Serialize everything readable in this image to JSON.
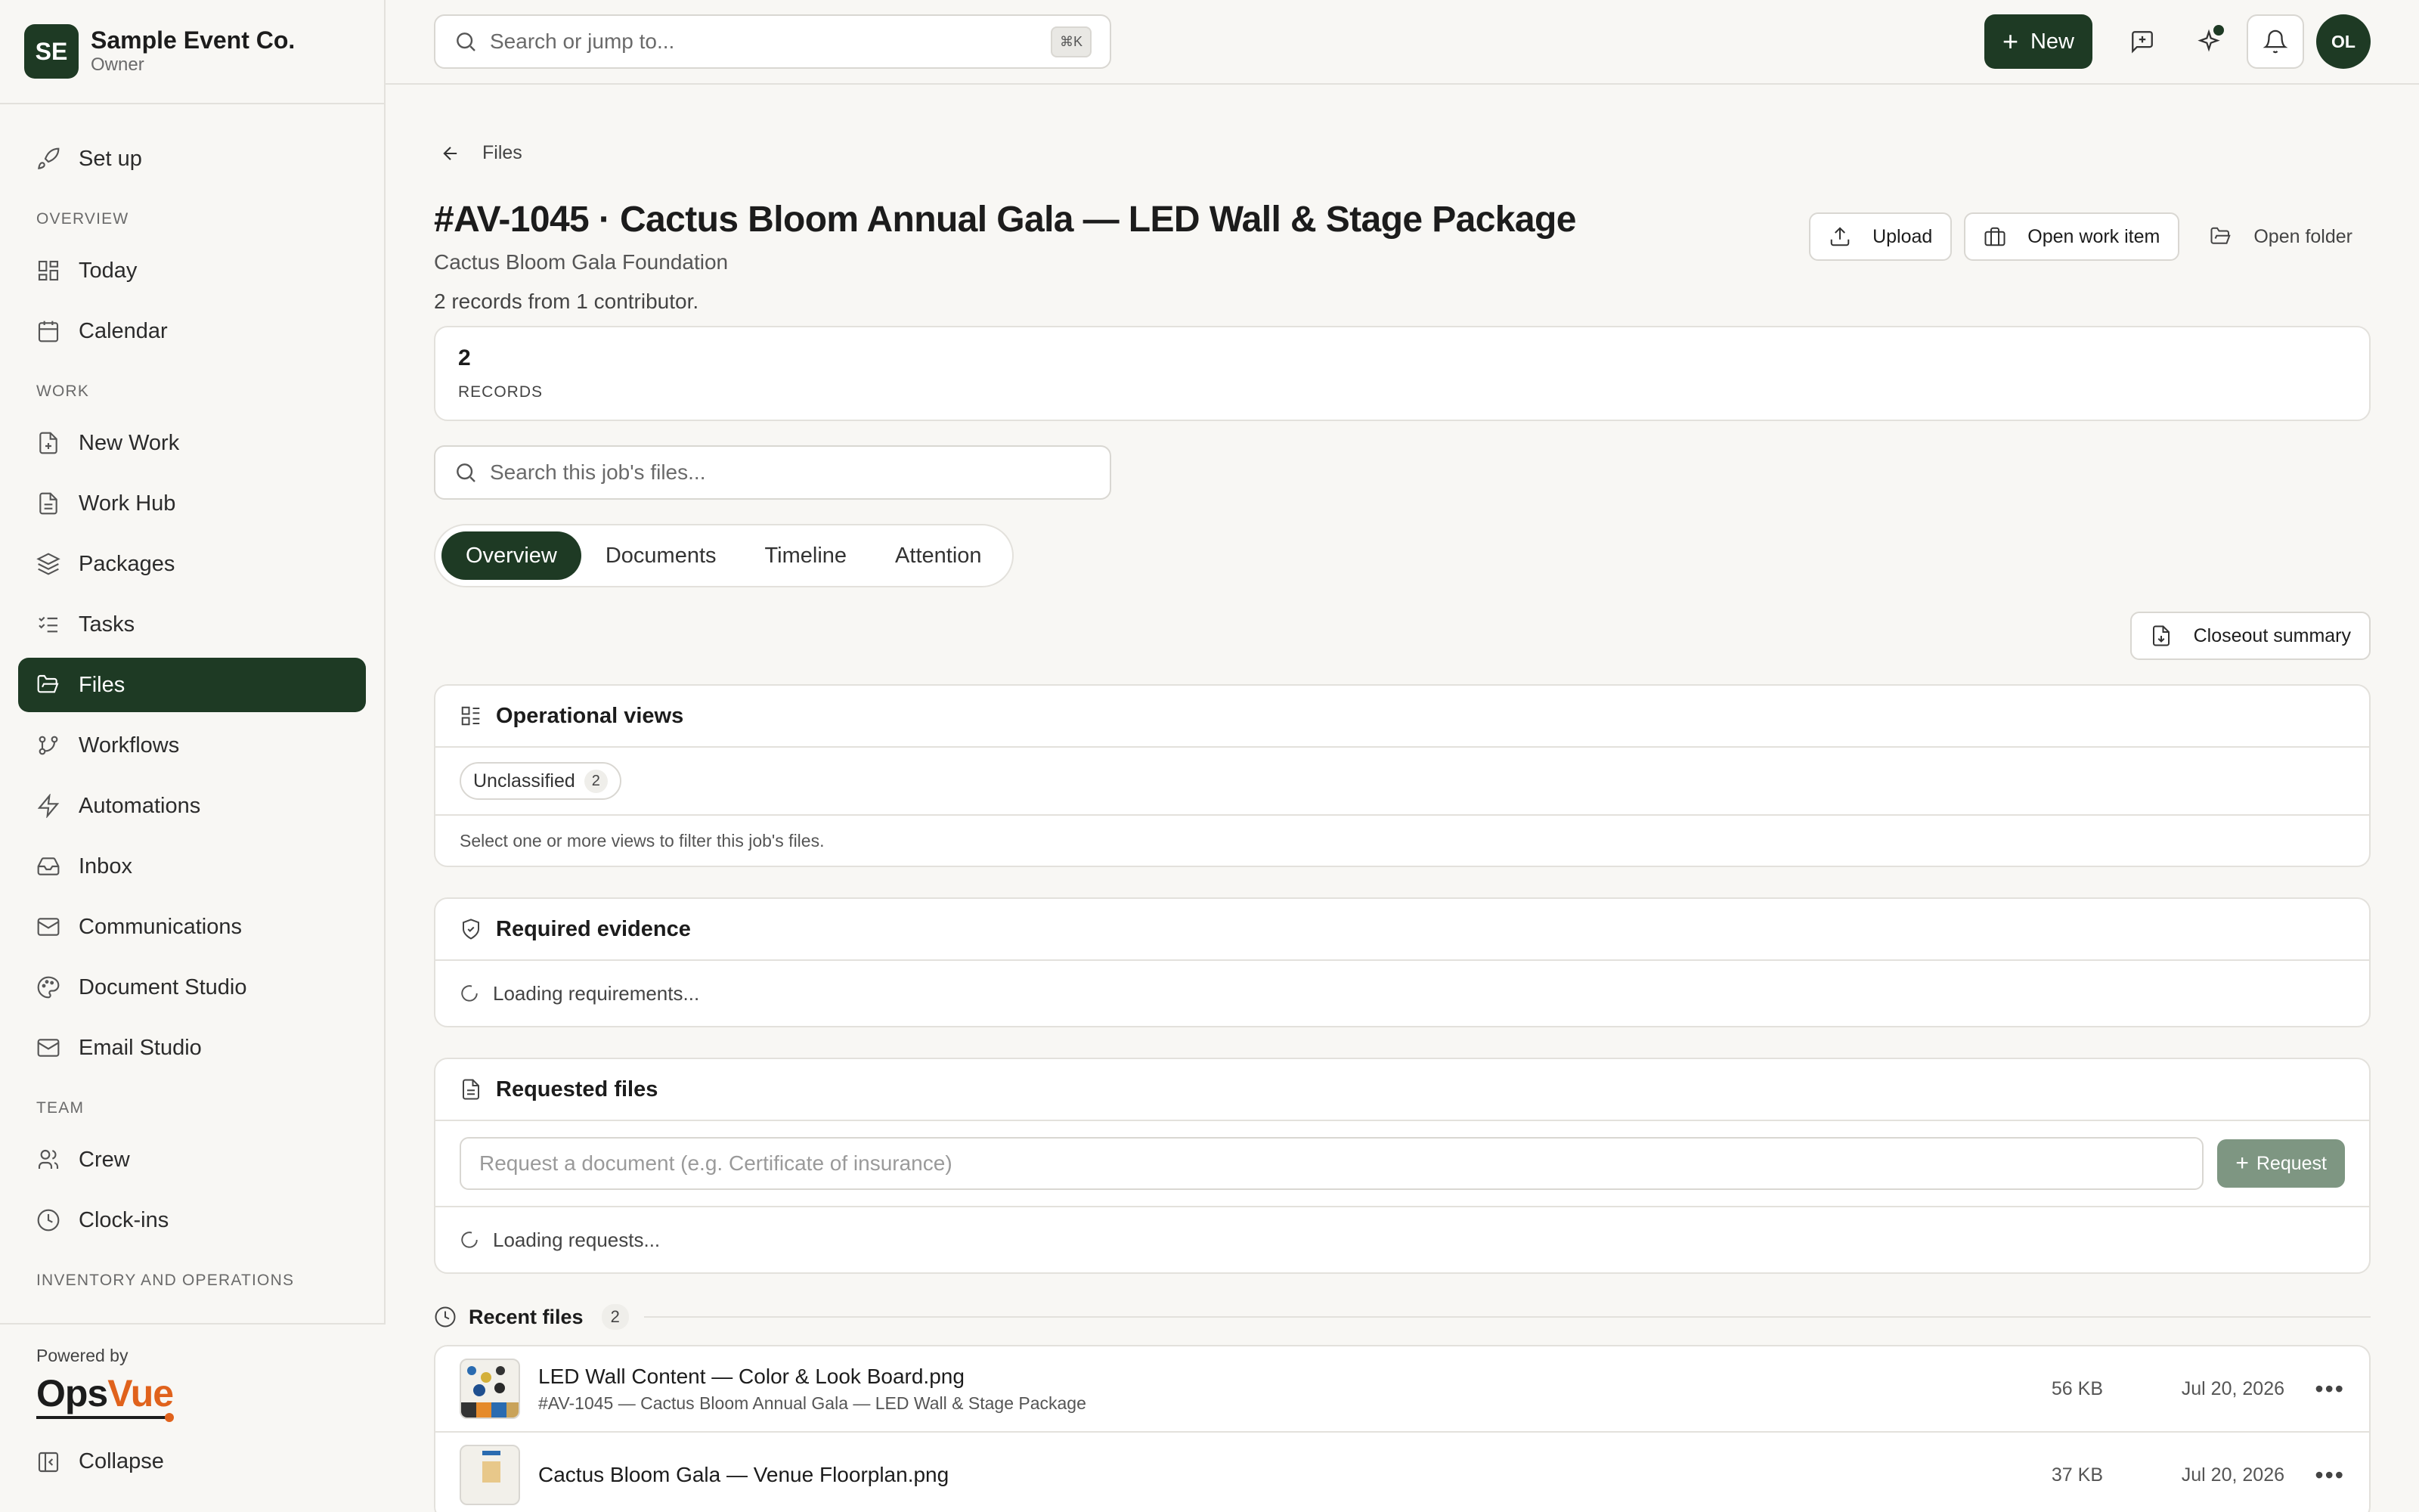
{
  "org": {
    "initials": "SE",
    "name": "Sample Event Co.",
    "role": "Owner"
  },
  "nav": {
    "setup": "Set up",
    "overview_label": "OVERVIEW",
    "overview": [
      "Today",
      "Calendar"
    ],
    "work_label": "WORK",
    "work": [
      "New Work",
      "Work Hub",
      "Packages",
      "Tasks",
      "Files",
      "Workflows",
      "Automations",
      "Inbox",
      "Communications",
      "Document Studio",
      "Email Studio"
    ],
    "team_label": "TEAM",
    "team": [
      "Crew",
      "Clock-ins"
    ],
    "inventory_label": "INVENTORY AND OPERATIONS",
    "active_item": "Files"
  },
  "footer": {
    "powered_by": "Powered by",
    "logo_ops": "Ops",
    "logo_vue": "Vue",
    "collapse": "Collapse"
  },
  "topbar": {
    "search_placeholder": "Search or jump to...",
    "shortcut": "⌘K",
    "new_label": "New",
    "user_initials": "OL"
  },
  "page": {
    "breadcrumb": "Files",
    "title": "#AV-1045 · Cactus Bloom Annual Gala — LED Wall & Stage Package",
    "subtitle": "Cactus Bloom Gala Foundation",
    "actions": {
      "upload": "Upload",
      "open_work_item": "Open work item",
      "open_folder": "Open folder"
    },
    "records_note": "2 records from 1 contributor.",
    "stat": {
      "value": "2",
      "label": "RECORDS"
    },
    "job_search_placeholder": "Search this job's files...",
    "tabs": [
      "Overview",
      "Documents",
      "Timeline",
      "Attention"
    ],
    "active_tab": "Overview",
    "closeout_label": "Closeout summary"
  },
  "operational_views": {
    "title": "Operational views",
    "pill_label": "Unclassified",
    "pill_count": "2",
    "note": "Select one or more views to filter this job's files."
  },
  "required_evidence": {
    "title": "Required evidence",
    "loading": "Loading requirements..."
  },
  "requested_files": {
    "title": "Requested files",
    "input_placeholder": "Request a document (e.g. Certificate of insurance)",
    "request_button": "Request",
    "loading": "Loading requests..."
  },
  "recent_files": {
    "title": "Recent files",
    "count": "2",
    "items": [
      {
        "name": "LED Wall Content — Color & Look Board.png",
        "sub": "#AV-1045 — Cactus Bloom Annual Gala — LED Wall & Stage Package",
        "size": "56 KB",
        "date": "Jul 20, 2026"
      },
      {
        "name": "Cactus Bloom Gala — Venue Floorplan.png",
        "sub": "",
        "size": "37 KB",
        "date": "Jul 20, 2026"
      }
    ]
  },
  "colors": {
    "brand": "#1e3a24",
    "accent": "#e0621c"
  }
}
